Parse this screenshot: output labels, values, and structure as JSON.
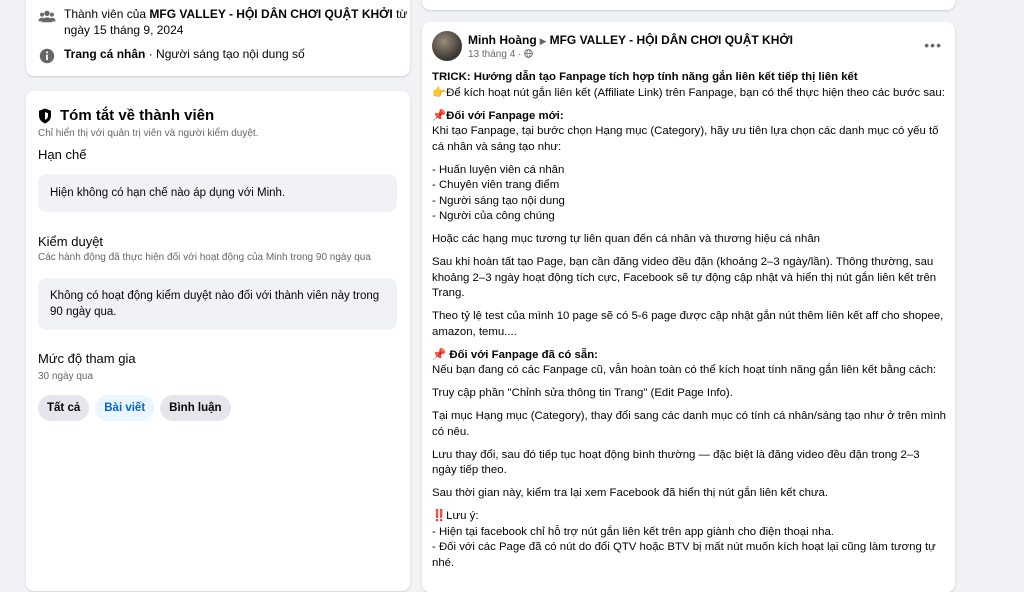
{
  "top_card": {
    "member_prefix": "Thành viên của ",
    "group_name": "MFG VALLEY - HỘI DÂN CHƠI QUẬT KHỞI",
    "member_suffix": " từ",
    "member_since": "ngày 15 tháng 9, 2024",
    "profile_bold": "Trang cá nhân",
    "profile_rest": " · Người sáng tạo nội dung số"
  },
  "summary": {
    "title": "Tóm tắt về thành viên",
    "note": "Chỉ hiển thị với quản trị viên và người kiểm duyệt.",
    "restriction_heading": "Hạn chế",
    "restriction_text": "Hiện không có hạn chế nào áp dụng với Minh.",
    "moderation_heading": "Kiểm duyệt",
    "moderation_note": "Các hành động đã thực hiện đối với hoạt động của Minh trong 90 ngày qua",
    "moderation_text": "Không có hoạt động kiểm duyệt nào đối với thành viên này trong 90 ngày qua.",
    "engagement_heading": "Mức độ tham gia",
    "engagement_note": "30 ngày qua",
    "chips": [
      "Tất cả",
      "Bài viết",
      "Bình luận"
    ]
  },
  "post": {
    "author": "Minh Hoàng",
    "arrow": "▶",
    "group": "MFG VALLEY - HỘI DÂN CHƠI QUẬT KHỞI",
    "date": "13 tháng 4 ·",
    "more": "•••",
    "lines": {
      "trick": "TRICK: Hướng dẫn tạo Fanpage tích hợp tính năng gắn liên kết tiếp thị liên kết",
      "intro": "👉Để kích hoạt nút gắn liên kết (Affiliate Link) trên Fanpage, bạn có thể thực hiện theo các bước sau:",
      "new_heading": "📌Đối với Fanpage mới:",
      "new_text": "Khi tạo Fanpage, tại bước chọn Hạng mục (Category), hãy ưu tiên lựa chọn các danh mục có yếu tố cá nhân và sáng tạo như:",
      "b1": "- Huấn luyện viên cá nhân",
      "b2": "- Chuyên viên trang điểm",
      "b3": "- Người sáng tạo nội dung",
      "b4": "- Người của công chúng",
      "similar": "Hoặc các hạng mục tương tự liên quan đến cá nhân và thương hiệu cá nhân",
      "after": "Sau khi hoàn tất tạo Page, bạn cần đăng video đều đặn (khoảng 2–3 ngày/lần). Thông thường, sau khoảng 2–3 ngày hoạt động tích cực, Facebook sẽ tự động cập nhật và hiển thị nút gắn liên kết trên Trang.",
      "test": "Theo tỷ lệ test của mình 10 page sẽ có 5-6 page được cập nhật gắn nút thêm liên kết aff cho shopee, amazon, temu....",
      "old_heading": "📌 Đối với Fanpage đã có sẵn:",
      "old_text": "Nếu bạn đang có các  Fanpage cũ, vẫn hoàn toàn có thể kích hoạt tính năng gắn liên kết bằng cách:",
      "access": "Truy cập phần \"Chỉnh sửa thông tin Trang\" (Edit Page Info).",
      "category": "Tại mục Hạng mục (Category), thay đổi sang các danh mục có tính cá nhân/sáng tạo như ở trên mình có nêu.",
      "save": "Lưu thay đổi, sau đó tiếp tục hoạt động bình thường — đặc biệt là đăng video đều đặn trong 2–3 ngày tiếp theo.",
      "check": "Sau thời gian này, kiểm tra lại xem Facebook đã hiển thị nút gắn liên kết chưa.",
      "note_heading": "‼️Lưu ý:",
      "n1": "- Hiện tại facebook chỉ hỗ trợ nút gắn liên kết trên app giành cho điện thoại nha.",
      "n2": "- Đối với các Page đã có nút do đổi QTV hoặc BTV bị mất nút muốn kích hoạt lại cũng làm tương tự nhé."
    }
  }
}
